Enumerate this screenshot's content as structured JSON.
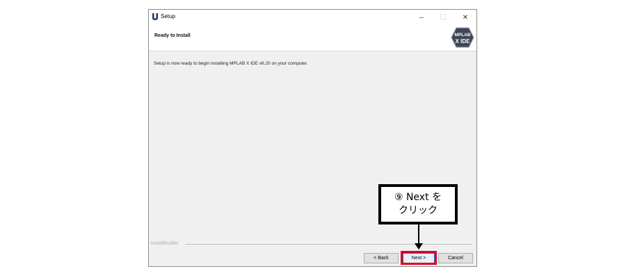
{
  "window": {
    "title": "Setup",
    "app_icon": "installbuilder-u-icon",
    "controls": {
      "minimize": "–",
      "maximize": "☐",
      "close": "✕"
    }
  },
  "header": {
    "page_title": "Ready to Install",
    "logo_line1": "MPLAB",
    "logo_line2": "X IDE"
  },
  "main": {
    "description": "Setup is now ready to begin installing MPLAB X IDE v6.20 on your computer."
  },
  "footer": {
    "brand_label": "InstallBuilder",
    "buttons": {
      "back": "< Back",
      "next": "Next >",
      "cancel": "Cancel"
    }
  },
  "annotation": {
    "callout_line1": "⑨ Next を",
    "callout_line2": "クリック",
    "highlight_color": "#e3001b"
  }
}
